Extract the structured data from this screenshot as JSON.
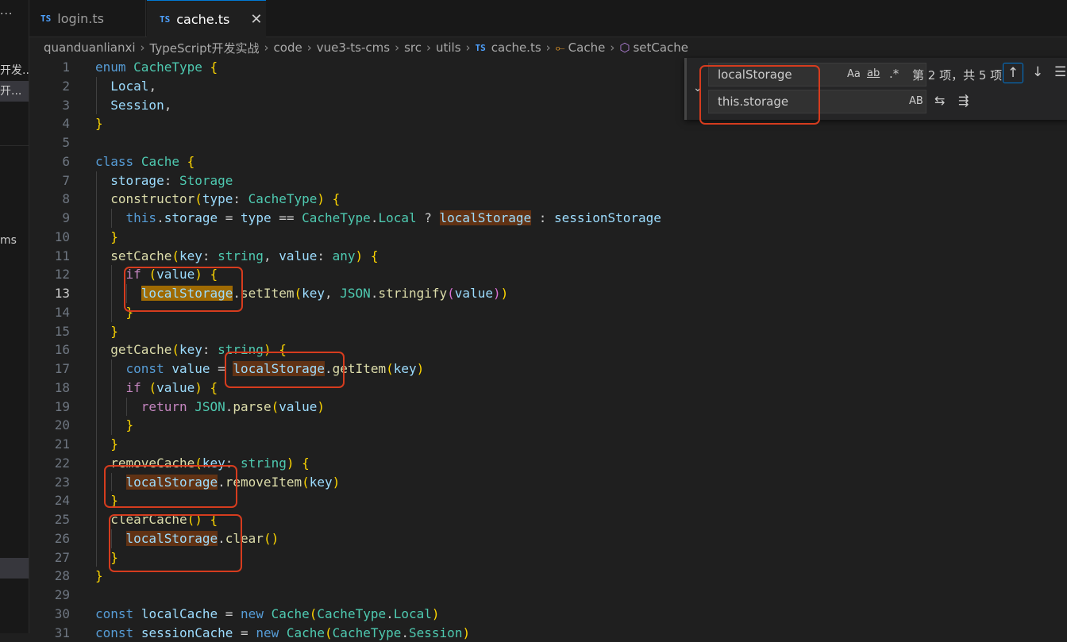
{
  "sidebar": {
    "more_label": "···",
    "items": [
      "开发...",
      "开...",
      "ms"
    ]
  },
  "tabs": [
    {
      "icon": "TS",
      "label": "login.ts",
      "active": false
    },
    {
      "icon": "TS",
      "label": "cache.ts",
      "active": true,
      "close": "✕"
    }
  ],
  "breadcrumb": [
    "quanduanlianxi",
    "TypeScript开发实战",
    "code",
    "vue3-ts-cms",
    "src",
    "utils",
    "cache.ts",
    "Cache",
    "setCache"
  ],
  "breadcrumb_file_icon": "TS",
  "find_widget": {
    "find_value": "localStorage",
    "replace_value": "this.storage",
    "match_case": "Aa",
    "whole_word": "ab",
    "regex": ".*",
    "preserve_case": "AB",
    "result_count": "第 2 项，共 5 项",
    "toggle_icon": "chevron-down-icon",
    "prev_icon": "arrow-up-icon",
    "next_icon": "arrow-down-icon",
    "selection_icon": "menu-icon",
    "replace_one_icon": "replace-icon",
    "replace_all_icon": "replace-all-icon"
  },
  "editor": {
    "current_line": 13,
    "lines": [
      "1",
      "2",
      "3",
      "4",
      "5",
      "6",
      "7",
      "8",
      "9",
      "10",
      "11",
      "12",
      "13",
      "14",
      "15",
      "16",
      "17",
      "18",
      "19",
      "20",
      "21",
      "22",
      "23",
      "24",
      "25",
      "26",
      "27",
      "28",
      "29",
      "30",
      "31"
    ],
    "code": [
      "enum CacheType {",
      "  Local,",
      "  Session,",
      "}",
      "",
      "class Cache {",
      "  storage: Storage",
      "  constructor(type: CacheType) {",
      "    this.storage = type == CacheType.Local ? localStorage : sessionStorage",
      "  }",
      "  setCache(key: string, value: any) {",
      "    if (value) {",
      "      localStorage.setItem(key, JSON.stringify(value))",
      "    }",
      "  }",
      "  getCache(key: string) {",
      "    const value = localStorage.getItem(key)",
      "    if (value) {",
      "      return JSON.parse(value)",
      "    }",
      "  }",
      "  removeCache(key: string) {",
      "    localStorage.removeItem(key)",
      "  }",
      "  clearCache() {",
      "    localStorage.clear()",
      "  }",
      "}",
      "",
      "const localCache = new Cache(CacheType.Local)",
      "const sessionCache = new Cache(CacheType.Session)"
    ]
  },
  "colors": {
    "background": "#1f1f1f",
    "keyword": "#569cd6",
    "class": "#4ec9b0",
    "property": "#9cdcfe",
    "function": "#dcdcaa",
    "control": "#c586c0",
    "match_highlight": "#613214",
    "current_match": "#9e6a03",
    "annotation_box": "#d63c1e"
  }
}
